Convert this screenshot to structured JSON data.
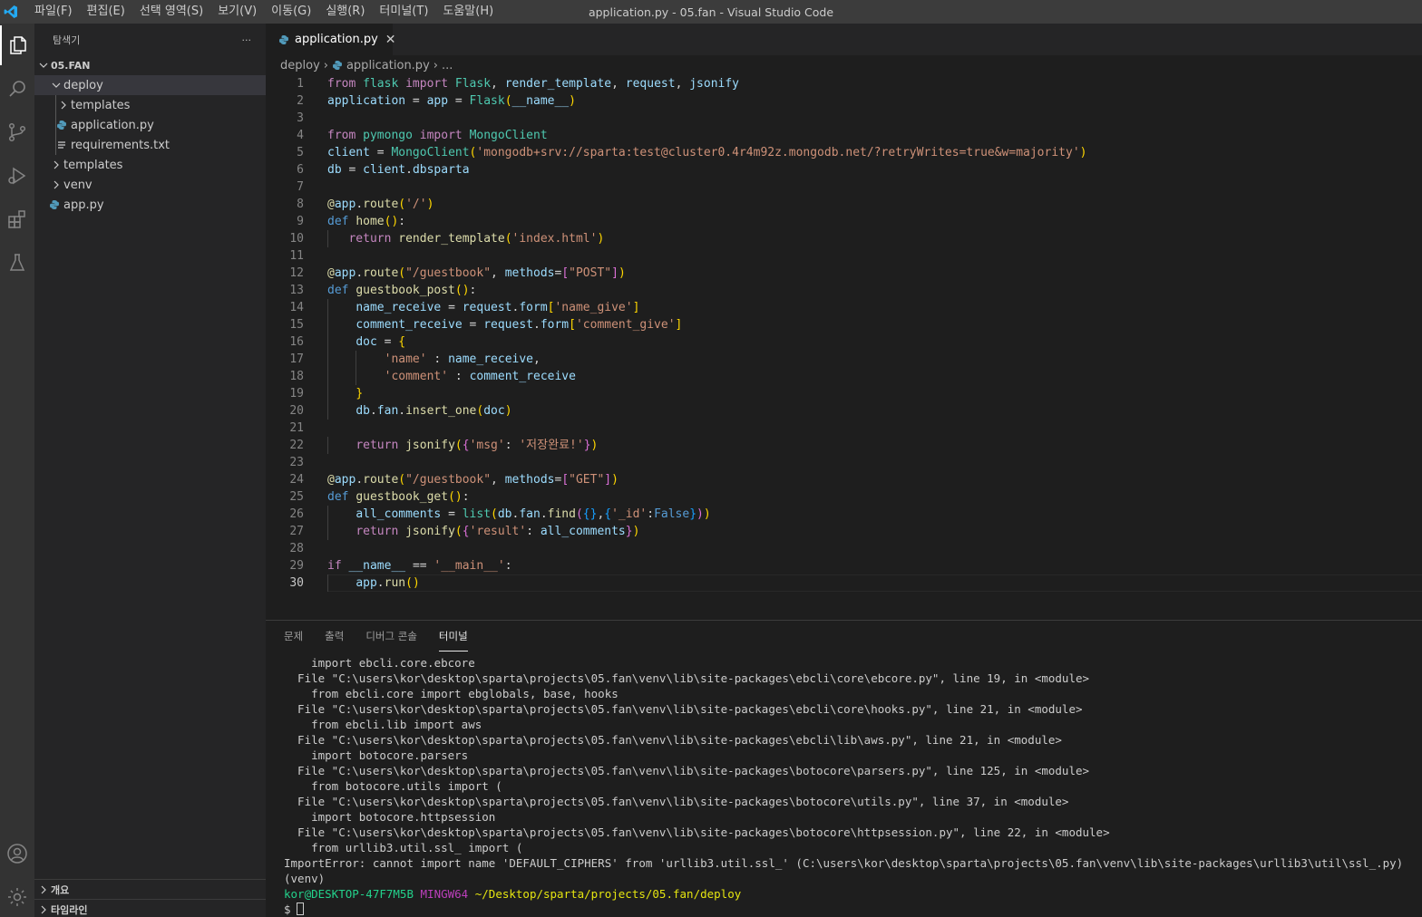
{
  "titlebar": {
    "menu": [
      "파일(F)",
      "편집(E)",
      "선택 영역(S)",
      "보기(V)",
      "이동(G)",
      "실행(R)",
      "터미널(T)",
      "도움말(H)"
    ],
    "window_title": "application.py - 05.fan - Visual Studio Code"
  },
  "activity_bar": [
    "explorer-icon",
    "search-icon",
    "source-control-icon",
    "run-debug-icon",
    "extensions-icon",
    "testing-icon",
    "account-icon",
    "settings-gear-icon"
  ],
  "sidebar": {
    "title": "탐색기",
    "more": "···",
    "root": "05.FAN",
    "tree": [
      {
        "label": "deploy",
        "type": "folder",
        "expanded": true,
        "depth": 1
      },
      {
        "label": "templates",
        "type": "folder",
        "expanded": false,
        "depth": 2
      },
      {
        "label": "application.py",
        "type": "python",
        "depth": 2
      },
      {
        "label": "requirements.txt",
        "type": "text",
        "depth": 2
      },
      {
        "label": "templates",
        "type": "folder",
        "expanded": false,
        "depth": 1
      },
      {
        "label": "venv",
        "type": "folder",
        "expanded": false,
        "depth": 1
      },
      {
        "label": "app.py",
        "type": "python",
        "depth": 1
      }
    ],
    "sections": [
      "개요",
      "타임라인"
    ]
  },
  "editor": {
    "tab_label": "application.py",
    "breadcrumb": [
      "deploy",
      "application.py",
      "..."
    ],
    "current_line": 30,
    "lines": [
      "from flask import Flask, render_template, request, jsonify",
      "application = app = Flask(__name__)",
      "",
      "from pymongo import MongoClient",
      "client = MongoClient('mongodb+srv://sparta:test@cluster0.4r4m92z.mongodb.net/?retryWrites=true&w=majority')",
      "db = client.dbsparta",
      "",
      "@app.route('/')",
      "def home():",
      "   return render_template('index.html')",
      "",
      "@app.route(\"/guestbook\", methods=[\"POST\"])",
      "def guestbook_post():",
      "    name_receive = request.form['name_give']",
      "    comment_receive = request.form['comment_give']",
      "    doc = {",
      "        'name' : name_receive,",
      "        'comment' : comment_receive",
      "    }",
      "    db.fan.insert_one(doc)",
      "",
      "    return jsonify({'msg': '저장완료!'})",
      "",
      "@app.route(\"/guestbook\", methods=[\"GET\"])",
      "def guestbook_get():",
      "    all_comments = list(db.fan.find({},{'_id':False}))",
      "    return jsonify({'result': all_comments})",
      "",
      "if __name__ == '__main__':",
      "    app.run()"
    ]
  },
  "panel": {
    "tabs": [
      "문제",
      "출력",
      "디버그 콘솔",
      "터미널"
    ],
    "active_tab": "터미널",
    "terminal_lines": [
      "    import ebcli.core.ebcore",
      "  File \"C:\\users\\kor\\desktop\\sparta\\projects\\05.fan\\venv\\lib\\site-packages\\ebcli\\core\\ebcore.py\", line 19, in <module>",
      "    from ebcli.core import ebglobals, base, hooks",
      "  File \"C:\\users\\kor\\desktop\\sparta\\projects\\05.fan\\venv\\lib\\site-packages\\ebcli\\core\\hooks.py\", line 21, in <module>",
      "    from ebcli.lib import aws",
      "  File \"C:\\users\\kor\\desktop\\sparta\\projects\\05.fan\\venv\\lib\\site-packages\\ebcli\\lib\\aws.py\", line 21, in <module>",
      "    import botocore.parsers",
      "  File \"C:\\users\\kor\\desktop\\sparta\\projects\\05.fan\\venv\\lib\\site-packages\\botocore\\parsers.py\", line 125, in <module>",
      "    from botocore.utils import (",
      "  File \"C:\\users\\kor\\desktop\\sparta\\projects\\05.fan\\venv\\lib\\site-packages\\botocore\\utils.py\", line 37, in <module>",
      "    import botocore.httpsession",
      "  File \"C:\\users\\kor\\desktop\\sparta\\projects\\05.fan\\venv\\lib\\site-packages\\botocore\\httpsession.py\", line 22, in <module>",
      "    from urllib3.util.ssl_ import (",
      "ImportError: cannot import name 'DEFAULT_CIPHERS' from 'urllib3.util.ssl_' (C:\\users\\kor\\desktop\\sparta\\projects\\05.fan\\venv\\lib\\site-packages\\urllib3\\util\\ssl_.py)",
      "(venv)"
    ],
    "prompt": {
      "user_host": "kor@DESKTOP-47F7M5B",
      "shell": "MINGW64",
      "path": "~/Desktop/sparta/projects/05.fan/deploy",
      "symbol": "$"
    }
  },
  "colors": {
    "accent": "#007acc",
    "python_icon": "#519aba",
    "background": "#1e1e1e",
    "sidebar": "#252526",
    "activity_bar": "#333333",
    "titlebar": "#3c3c3c"
  }
}
